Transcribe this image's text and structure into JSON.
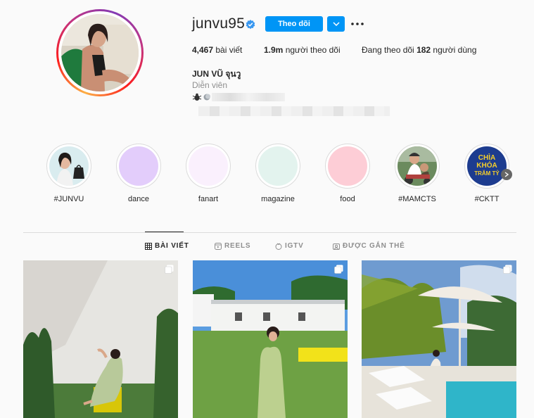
{
  "profile": {
    "username": "junvu95",
    "full_name": "JUN VŨ จุนวู",
    "category": "Diễn viên",
    "follow_button": "Theo dõi"
  },
  "stats": {
    "posts_count": "4,467",
    "posts_label": " bài viết",
    "followers_count": "1.9m",
    "followers_label": " người theo dõi",
    "following_prefix": "Đang theo dõi ",
    "following_count": "182",
    "following_label": " người dùng"
  },
  "highlights": [
    {
      "label": "#JUNVU"
    },
    {
      "label": "dance"
    },
    {
      "label": "fanart"
    },
    {
      "label": "magazine"
    },
    {
      "label": "food"
    },
    {
      "label": "#MAMCTS"
    },
    {
      "label": "#CKTT"
    }
  ],
  "highlight_art": {
    "ckt_text_1": "CHÌA",
    "ckt_text_2": "KHÓA",
    "ckt_text_3": "TRĂM TỶ"
  },
  "tabs": [
    {
      "label": "BÀI VIẾT",
      "active": true
    },
    {
      "label": "REELS"
    },
    {
      "label": "IGTV"
    },
    {
      "label": "ĐƯỢC GẮN THẺ"
    }
  ],
  "colors": {
    "accent": "#0095f6",
    "dance": "#e3cdfb",
    "fanart": "#faf0fd",
    "magazine": "#e3f3ee",
    "food": "#fdcdd6"
  }
}
